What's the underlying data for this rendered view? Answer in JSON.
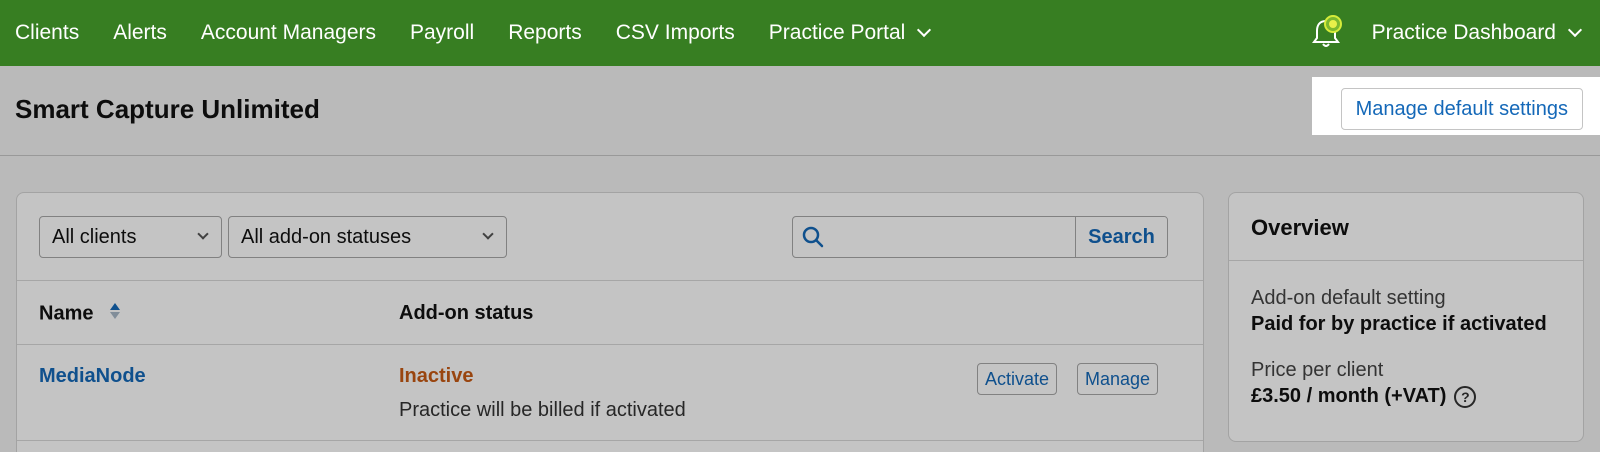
{
  "nav": {
    "items": [
      "Clients",
      "Alerts",
      "Account Managers",
      "Payroll",
      "Reports",
      "CSV Imports",
      "Practice Portal"
    ],
    "right_label": "Practice Dashboard",
    "brand_color": "#377e22",
    "notification_icon": "bell-icon"
  },
  "header": {
    "title": "Smart Capture Unlimited",
    "manage_button": "Manage default settings"
  },
  "filters": {
    "client_filter": "All clients",
    "status_filter": "All add-on statuses",
    "search_placeholder": "",
    "search_button": "Search"
  },
  "table": {
    "columns": [
      "Name",
      "Add-on status"
    ],
    "rows": [
      {
        "name": "MediaNode",
        "status": "Inactive",
        "note": "Practice will be billed if activated",
        "actions": [
          "Activate",
          "Manage"
        ]
      }
    ]
  },
  "overview": {
    "title": "Overview",
    "default_setting_label": "Add-on default setting",
    "default_setting_value": "Paid for by practice if activated",
    "price_label": "Price per client",
    "price_value": "£3.50 / month (+VAT)",
    "help_glyph": "?"
  }
}
